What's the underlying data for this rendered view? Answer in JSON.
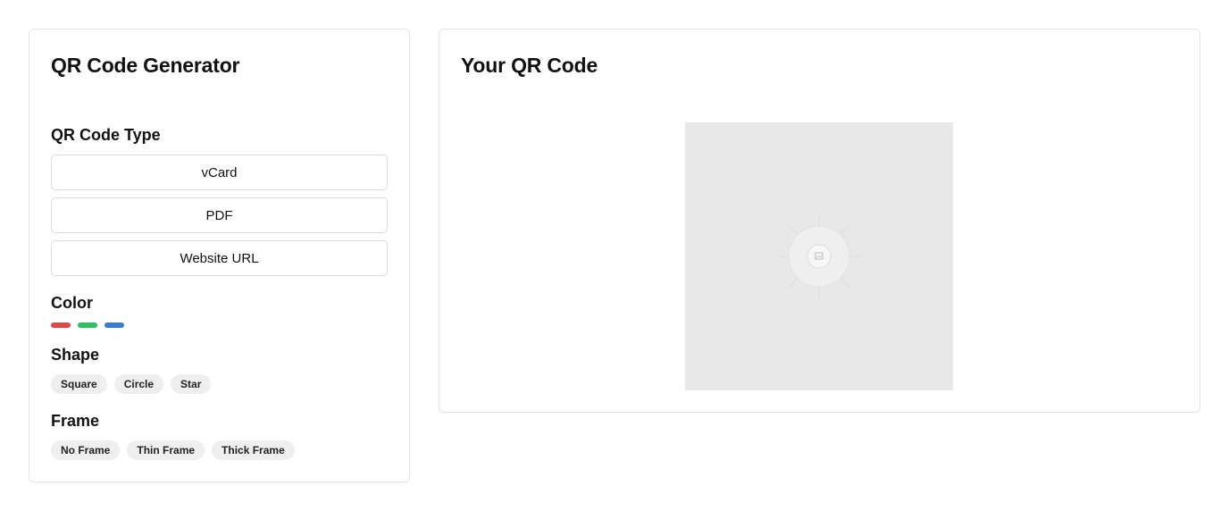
{
  "generator": {
    "title": "QR Code Generator",
    "type_section": {
      "label": "QR Code Type",
      "options": [
        "vCard",
        "PDF",
        "Website URL"
      ]
    },
    "color_section": {
      "label": "Color",
      "swatches": [
        "#e04848",
        "#2fbf63",
        "#3a7bd5"
      ]
    },
    "shape_section": {
      "label": "Shape",
      "options": [
        "Square",
        "Circle",
        "Star"
      ]
    },
    "frame_section": {
      "label": "Frame",
      "options": [
        "No Frame",
        "Thin Frame",
        "Thick Frame"
      ]
    }
  },
  "preview": {
    "title": "Your QR Code",
    "placeholder_icon": "image-placeholder-icon"
  }
}
